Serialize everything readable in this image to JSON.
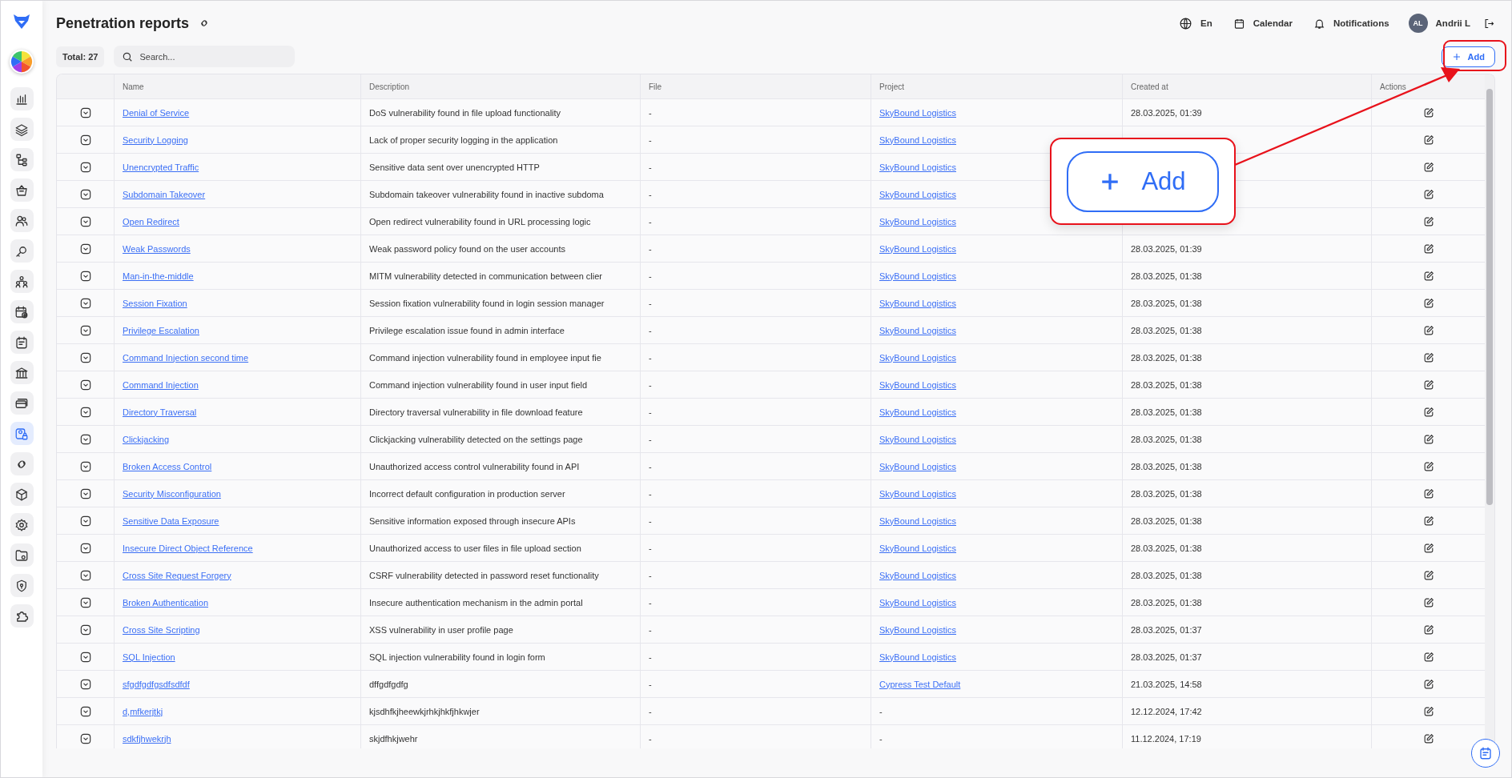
{
  "sidebar": {
    "items": [
      {
        "selected": false
      },
      {
        "selected": false
      },
      {
        "selected": false
      },
      {
        "selected": false
      },
      {
        "selected": false
      },
      {
        "selected": false
      },
      {
        "selected": false
      },
      {
        "selected": false
      },
      {
        "selected": false
      },
      {
        "selected": false
      },
      {
        "selected": false
      },
      {
        "selected": true
      },
      {
        "selected": false
      },
      {
        "selected": false
      },
      {
        "selected": false
      },
      {
        "selected": false
      },
      {
        "selected": false
      },
      {
        "selected": false
      }
    ]
  },
  "page": {
    "title": "Penetration reports"
  },
  "topbar": {
    "language": "En",
    "calendar": "Calendar",
    "notifications": "Notifications",
    "user": {
      "initials": "AL",
      "name": "Andrii L"
    }
  },
  "toolbar": {
    "total": "Total: 27",
    "search": {
      "placeholder": "Search..."
    },
    "add_button": "Add"
  },
  "table": {
    "columns": [
      "Name",
      "Description",
      "File",
      "Project",
      "Created at",
      "Actions"
    ],
    "rows": [
      {
        "name": "Denial of Service",
        "description": "DoS vulnerability found in file upload functionality",
        "file": "-",
        "project": "SkyBound Logistics",
        "linked": true,
        "created_at": "28.03.2025, 01:39"
      },
      {
        "name": "Security Logging",
        "description": "Lack of proper security logging in the application",
        "file": "-",
        "project": "SkyBound Logistics",
        "linked": true
      },
      {
        "name": "Unencrypted Traffic",
        "description": "Sensitive data sent over unencrypted HTTP",
        "file": "-",
        "project": "SkyBound Logistics",
        "linked": true
      },
      {
        "name": "Subdomain Takeover",
        "description": "Subdomain takeover vulnerability found in inactive subdoma",
        "file": "-",
        "project": "SkyBound Logistics",
        "linked": true
      },
      {
        "name": "Open Redirect",
        "description": "Open redirect vulnerability found in URL processing logic",
        "file": "-",
        "project": "SkyBound Logistics",
        "linked": true
      },
      {
        "name": "Weak Passwords",
        "description": "Weak password policy found on the user accounts",
        "file": "-",
        "project": "SkyBound Logistics",
        "linked": true,
        "created_at": "28.03.2025, 01:39"
      },
      {
        "name": "Man-in-the-middle",
        "description": "MITM vulnerability detected in communication between clier",
        "file": "-",
        "project": "SkyBound Logistics",
        "linked": true,
        "created_at": "28.03.2025, 01:38"
      },
      {
        "name": "Session Fixation",
        "description": "Session fixation vulnerability found in login session manager",
        "file": "-",
        "project": "SkyBound Logistics",
        "linked": true,
        "created_at": "28.03.2025, 01:38"
      },
      {
        "name": "Privilege Escalation",
        "description": "Privilege escalation issue found in admin interface",
        "file": "-",
        "project": "SkyBound Logistics",
        "linked": true,
        "created_at": "28.03.2025, 01:38"
      },
      {
        "name": "Command Injection second time",
        "description": "Command injection vulnerability found in employee input fie",
        "file": "-",
        "project": "SkyBound Logistics",
        "linked": true,
        "created_at": "28.03.2025, 01:38"
      },
      {
        "name": "Command Injection",
        "description": "Command injection vulnerability found in user input field",
        "file": "-",
        "project": "SkyBound Logistics",
        "linked": true,
        "created_at": "28.03.2025, 01:38"
      },
      {
        "name": "Directory Traversal",
        "description": "Directory traversal vulnerability in file download feature",
        "file": "-",
        "project": "SkyBound Logistics",
        "linked": true,
        "created_at": "28.03.2025, 01:38"
      },
      {
        "name": "Clickjacking",
        "description": "Clickjacking vulnerability detected on the settings page",
        "file": "-",
        "project": "SkyBound Logistics",
        "linked": true,
        "created_at": "28.03.2025, 01:38"
      },
      {
        "name": "Broken Access Control",
        "description": "Unauthorized access control vulnerability found in API",
        "file": "-",
        "project": "SkyBound Logistics",
        "linked": true,
        "created_at": "28.03.2025, 01:38"
      },
      {
        "name": "Security Misconfiguration",
        "description": "Incorrect default configuration in production server",
        "file": "-",
        "project": "SkyBound Logistics",
        "linked": true,
        "created_at": "28.03.2025, 01:38"
      },
      {
        "name": "Sensitive Data Exposure",
        "description": "Sensitive information exposed through insecure APIs",
        "file": "-",
        "project": "SkyBound Logistics",
        "linked": true,
        "created_at": "28.03.2025, 01:38"
      },
      {
        "name": "Insecure Direct Object Reference",
        "description": "Unauthorized access to user files in file upload section",
        "file": "-",
        "project": "SkyBound Logistics",
        "linked": true,
        "created_at": "28.03.2025, 01:38"
      },
      {
        "name": "Cross Site Request Forgery",
        "description": "CSRF vulnerability detected in password reset functionality",
        "file": "-",
        "project": "SkyBound Logistics",
        "linked": true,
        "created_at": "28.03.2025, 01:38"
      },
      {
        "name": "Broken Authentication",
        "description": "Insecure authentication mechanism in the admin portal",
        "file": "-",
        "project": "SkyBound Logistics",
        "linked": true,
        "created_at": "28.03.2025, 01:38"
      },
      {
        "name": "Cross Site Scripting",
        "description": "XSS vulnerability in user profile page",
        "file": "-",
        "project": "SkyBound Logistics",
        "linked": true,
        "created_at": "28.03.2025, 01:37"
      },
      {
        "name": "SQL Injection",
        "description": "SQL injection vulnerability found in login form",
        "file": "-",
        "project": "SkyBound Logistics",
        "linked": true,
        "created_at": "28.03.2025, 01:37"
      },
      {
        "name": "sfgdfgdfgsdfsdfdf",
        "description": "dffgdfgdfg",
        "file": "-",
        "project": "Cypress Test Default",
        "linked": true,
        "created_at": "21.03.2025, 14:58"
      },
      {
        "name": "d,mfkerjtkj",
        "description": "kjsdhfkjheewkjrhkjhkfjhkwjer",
        "file": "-",
        "project": "-",
        "linked": false,
        "created_at": "12.12.2024, 17:42"
      },
      {
        "name": "sdkfjhwekrjh",
        "description": "skjdfhkjwehr",
        "file": "-",
        "project": "-",
        "linked": false,
        "created_at": "11.12.2024, 17:19"
      }
    ]
  },
  "callout": {
    "label": "Add"
  }
}
